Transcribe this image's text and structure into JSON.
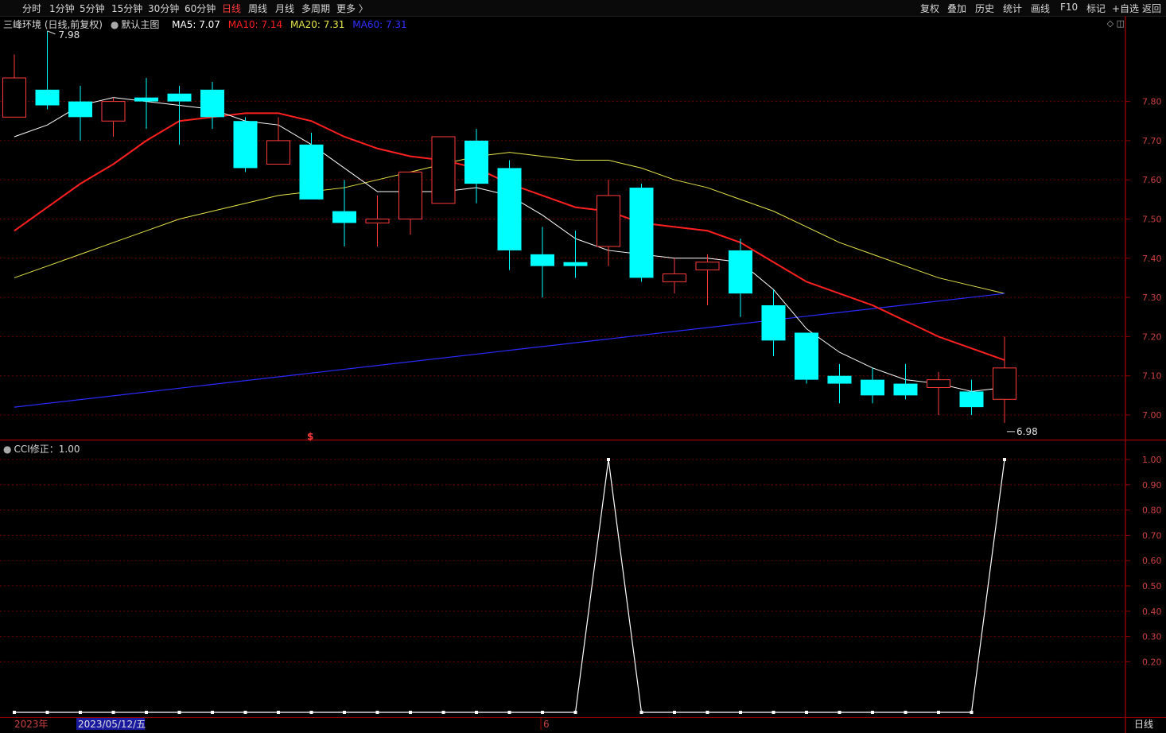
{
  "toolbar": {
    "left": [
      "分时",
      "1分钟",
      "5分钟",
      "15分钟",
      "30分钟",
      "60分钟",
      "日线",
      "周线",
      "月线",
      "多周期",
      "更多 〉"
    ],
    "active": "日线",
    "right": [
      "复权",
      "叠加",
      "历史",
      "统计",
      "画线",
      "F10",
      "标记",
      "+自选",
      "返回"
    ]
  },
  "legend": {
    "stock": "三峰环境 (日线,前复权)",
    "template": "默认主图",
    "ma5": "MA5: 7.07",
    "ma10": "MA10: 7.14",
    "ma20": "MA20: 7.31",
    "ma60": "MA60: 7.31"
  },
  "cci_legend": "CCI修正：1.00",
  "markers": {
    "high": "7.98",
    "low": "6.98",
    "signal": "$",
    "period_button": "日线"
  },
  "x_axis": {
    "year": "2023年",
    "cursor_date": "2023/05/12/五",
    "month": "6"
  },
  "colors": {
    "up": "#ff3b3b",
    "down": "#00ffff",
    "ma5": "#ffffff",
    "ma10": "#ff2020",
    "ma20": "#e6e64a",
    "ma60": "#2a2aff",
    "grid": "#6b0000",
    "cci": "#ffffff"
  },
  "chart_data": [
    {
      "type": "candlestick",
      "y_ticks": [
        "7.80",
        "7.70",
        "7.60",
        "7.50",
        "7.40",
        "7.30",
        "7.20",
        "7.10",
        "7.00"
      ],
      "candles": [
        {
          "o": 7.76,
          "c": 7.86,
          "h": 7.92,
          "l": 7.76
        },
        {
          "o": 7.83,
          "c": 7.79,
          "h": 7.98,
          "l": 7.78
        },
        {
          "o": 7.8,
          "c": 7.76,
          "h": 7.84,
          "l": 7.7
        },
        {
          "o": 7.75,
          "c": 7.8,
          "h": 7.81,
          "l": 7.71
        },
        {
          "o": 7.81,
          "c": 7.8,
          "h": 7.86,
          "l": 7.73
        },
        {
          "o": 7.82,
          "c": 7.8,
          "h": 7.84,
          "l": 7.69
        },
        {
          "o": 7.83,
          "c": 7.76,
          "h": 7.85,
          "l": 7.73
        },
        {
          "o": 7.75,
          "c": 7.63,
          "h": 7.76,
          "l": 7.62
        },
        {
          "o": 7.64,
          "c": 7.7,
          "h": 7.76,
          "l": 7.64
        },
        {
          "o": 7.69,
          "c": 7.55,
          "h": 7.72,
          "l": 7.55
        },
        {
          "o": 7.52,
          "c": 7.49,
          "h": 7.6,
          "l": 7.43
        },
        {
          "o": 7.49,
          "c": 7.5,
          "h": 7.56,
          "l": 7.43
        },
        {
          "o": 7.5,
          "c": 7.62,
          "h": 7.62,
          "l": 7.46
        },
        {
          "o": 7.54,
          "c": 7.71,
          "h": 7.71,
          "l": 7.54
        },
        {
          "o": 7.7,
          "c": 7.59,
          "h": 7.73,
          "l": 7.54
        },
        {
          "o": 7.63,
          "c": 7.42,
          "h": 7.65,
          "l": 7.37
        },
        {
          "o": 7.41,
          "c": 7.38,
          "h": 7.48,
          "l": 7.3
        },
        {
          "o": 7.39,
          "c": 7.38,
          "h": 7.47,
          "l": 7.35
        },
        {
          "o": 7.43,
          "c": 7.56,
          "h": 7.6,
          "l": 7.38
        },
        {
          "o": 7.58,
          "c": 7.35,
          "h": 7.59,
          "l": 7.34
        },
        {
          "o": 7.34,
          "c": 7.36,
          "h": 7.4,
          "l": 7.31
        },
        {
          "o": 7.37,
          "c": 7.39,
          "h": 7.41,
          "l": 7.28
        },
        {
          "o": 7.42,
          "c": 7.31,
          "h": 7.45,
          "l": 7.25
        },
        {
          "o": 7.28,
          "c": 7.19,
          "h": 7.32,
          "l": 7.15
        },
        {
          "o": 7.21,
          "c": 7.09,
          "h": 7.21,
          "l": 7.08
        },
        {
          "o": 7.1,
          "c": 7.08,
          "h": 7.13,
          "l": 7.03
        },
        {
          "o": 7.09,
          "c": 7.05,
          "h": 7.12,
          "l": 7.03
        },
        {
          "o": 7.08,
          "c": 7.05,
          "h": 7.13,
          "l": 7.04
        },
        {
          "o": 7.07,
          "c": 7.09,
          "h": 7.11,
          "l": 7.0
        },
        {
          "o": 7.06,
          "c": 7.02,
          "h": 7.09,
          "l": 7.0
        },
        {
          "o": 7.04,
          "c": 7.12,
          "h": 7.2,
          "l": 6.98
        }
      ],
      "ma5": [
        7.71,
        7.74,
        7.79,
        7.81,
        7.8,
        7.79,
        7.78,
        7.75,
        7.74,
        7.69,
        7.63,
        7.57,
        7.57,
        7.57,
        7.58,
        7.56,
        7.51,
        7.45,
        7.42,
        7.41,
        7.4,
        7.4,
        7.39,
        7.32,
        7.22,
        7.16,
        7.12,
        7.09,
        7.08,
        7.06,
        7.07
      ],
      "ma10": [
        7.47,
        7.53,
        7.59,
        7.64,
        7.7,
        7.75,
        7.76,
        7.77,
        7.77,
        7.75,
        7.71,
        7.68,
        7.66,
        7.65,
        7.63,
        7.59,
        7.56,
        7.53,
        7.52,
        7.49,
        7.48,
        7.47,
        7.44,
        7.39,
        7.34,
        7.31,
        7.28,
        7.24,
        7.2,
        7.17,
        7.14
      ],
      "ma20": [
        7.35,
        7.38,
        7.41,
        7.44,
        7.47,
        7.5,
        7.52,
        7.54,
        7.56,
        7.57,
        7.58,
        7.6,
        7.62,
        7.64,
        7.66,
        7.67,
        7.66,
        7.65,
        7.65,
        7.63,
        7.6,
        7.58,
        7.55,
        7.52,
        7.48,
        7.44,
        7.41,
        7.38,
        7.35,
        7.33,
        7.31
      ],
      "ma60_start": 7.02,
      "ma60_end": 7.31
    },
    {
      "type": "line",
      "name": "CCI修正",
      "y_ticks": [
        "1.00",
        "0.90",
        "0.80",
        "0.70",
        "0.60",
        "0.50",
        "0.40",
        "0.30",
        "0.20"
      ],
      "values": [
        0,
        0,
        0,
        0,
        0,
        0,
        0,
        0,
        0,
        0,
        0,
        0,
        0,
        0,
        0,
        0,
        0,
        0,
        1,
        0,
        0,
        0,
        0,
        0,
        0,
        0,
        0,
        0,
        0,
        0,
        1
      ],
      "ylim": [
        0,
        1
      ]
    }
  ]
}
